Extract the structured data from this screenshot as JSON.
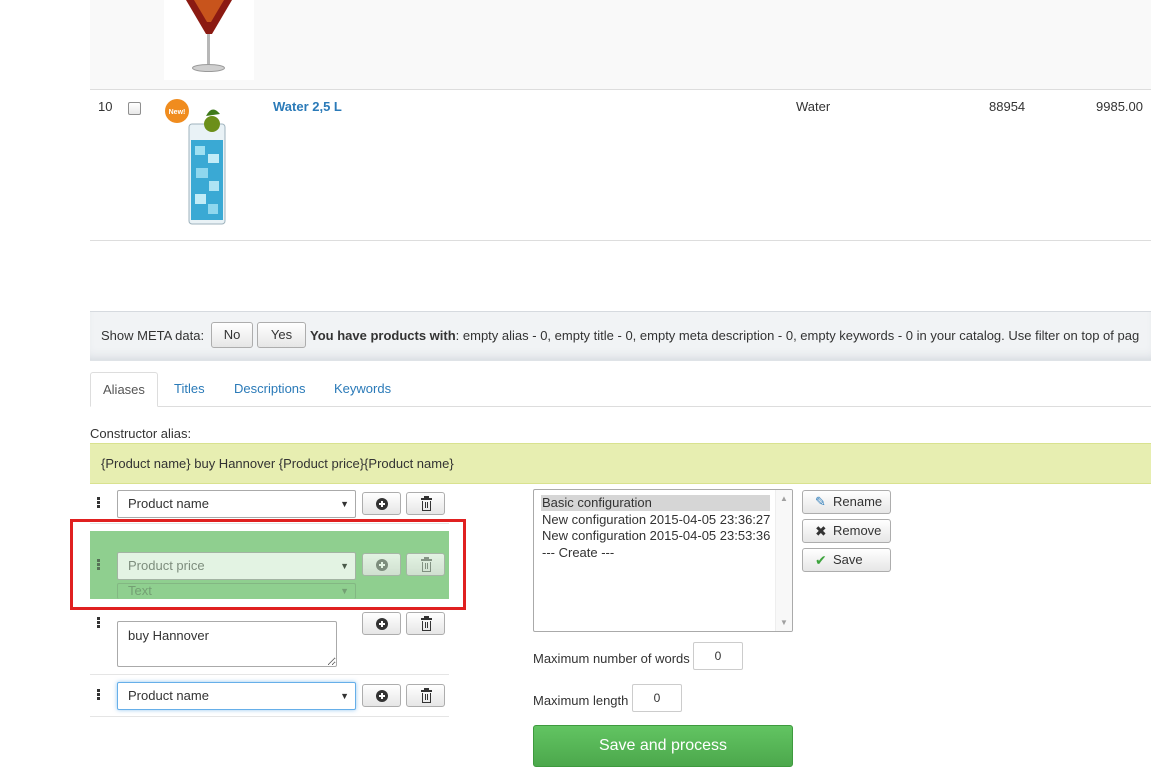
{
  "table": {
    "rows": [
      {
        "index": "10",
        "badge": "New!",
        "name": "Water 2,5 L",
        "category": "Water",
        "code": "88954",
        "price": "9985.00"
      }
    ]
  },
  "meta": {
    "label": "Show META data:",
    "no_label": "No",
    "yes_label": "Yes",
    "info_bold": "You have products with",
    "info_text": ": empty alias - 0, empty title - 0, empty meta description - 0, empty keywords - 0 in your catalog. Use filter on top of pag"
  },
  "tabs": [
    {
      "label": "Aliases",
      "active": true
    },
    {
      "label": "Titles"
    },
    {
      "label": "Descriptions"
    },
    {
      "label": "Keywords"
    }
  ],
  "constructor": {
    "label": "Constructor alias:",
    "preview": "{Product name} buy Hannover {Product price}{Product name}",
    "rows": [
      {
        "type": "select",
        "value": "Product name"
      },
      {
        "type": "select",
        "value": "Product price",
        "dragging": true,
        "below_value": "Text"
      },
      {
        "type": "text",
        "value": "buy Hannover"
      },
      {
        "type": "select",
        "value": "Product name",
        "focused": true
      }
    ]
  },
  "configs": {
    "items": [
      {
        "label": "Basic configuration",
        "selected": true
      },
      {
        "label": "New configuration 2015-04-05 23:36:27"
      },
      {
        "label": "New configuration 2015-04-05 23:53:36"
      },
      {
        "label": "--- Create ---"
      }
    ],
    "rename_label": "Rename",
    "remove_label": "Remove",
    "save_label": "Save"
  },
  "limits": {
    "max_words_label": "Maximum number of words",
    "max_words_value": "0",
    "max_length_label": "Maximum length",
    "max_length_value": "0"
  },
  "actions": {
    "save_process_label": "Save and process"
  },
  "colors": {
    "link": "#2a7ab8",
    "preview_bg": "#e7eeb1",
    "drag_ghost": "#8fcf8f",
    "highlight": "#e02020",
    "primary_green": "#5cb85c"
  }
}
